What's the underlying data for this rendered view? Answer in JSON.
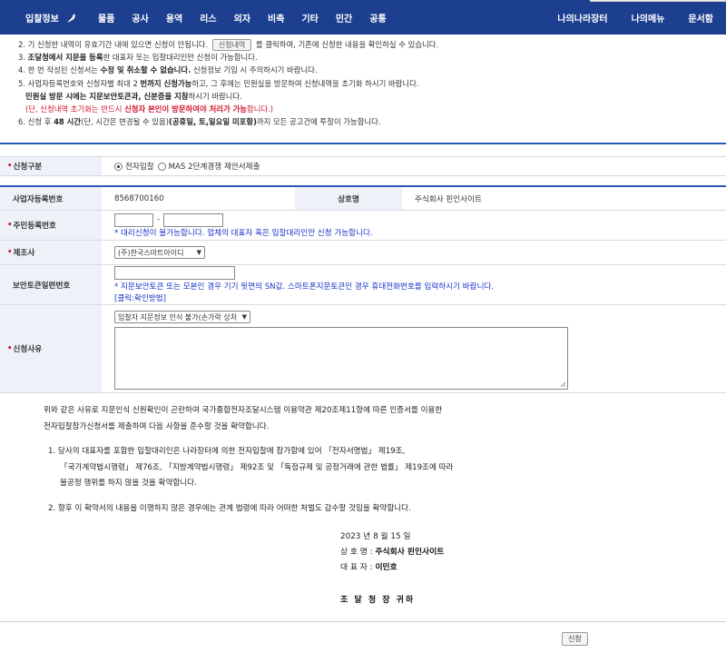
{
  "nav": {
    "logo": "입찰정보",
    "menu": [
      "물품",
      "공사",
      "용역",
      "리스",
      "외자",
      "비축",
      "기타",
      "민간",
      "공통"
    ],
    "right": [
      "나의나라장터",
      "나의메뉴",
      "문서함"
    ]
  },
  "notices": {
    "n2_pre": "2. 기 신청한 내역이 유효기간 내에 있으면 신청이 안됩니다.",
    "n2_btn": "신청내역",
    "n2_post": "를 클릭하여, 기존에 신청한 내용을 확인하실 수 있습니다.",
    "n3_pre": "3.",
    "n3_bold": "조달청에서 지문을 등록",
    "n3_post": "한 대표자 또는 입찰대리인만 신청이 가능합니다.",
    "n4_pre": "4. 한 번 작성된 신청서는",
    "n4_bold": "수정 및 취소할 수 없습니다.",
    "n4_post": "신청정보 기입 시 주의하시기 바랍니다.",
    "n5_pre": "5. 사업자등록번호와 신청자별 최대 2",
    "n5_bold": "번까지 신청가능",
    "n5_post": "하고, 그 후에는 민원실을 방문하여 신청내역을 초기화 하시기 바랍니다.",
    "n5b_bold1": "민원실 방문 시에는 지문보안토큰과, 신분증을 지참",
    "n5b_post": "하시기 바랍니다.",
    "n5c_pre": "(단, 신청내역 초기화는 반드시",
    "n5c_bold": "신청자 본인이 방문하여야 처리가 가능",
    "n5c_post": "합니다.)",
    "n6_pre": "6. 신청 후",
    "n6_bold1": "48 시간",
    "n6_mid": "(단, 시간은 변경될 수 있음)",
    "n6_bold2": "(공휴일, 토,일요일 미포함)",
    "n6_post": "까지 모든 공고건에 투찰이 가능합니다."
  },
  "form": {
    "req_type_label": "신청구분",
    "req_type_opt1": "전자입찰",
    "req_type_opt2": "MAS 2단계경쟁 제안서제출",
    "biz_no_label": "사업자등록번호",
    "biz_no_value": "8568700160",
    "company_label": "상호명",
    "company_value": "주식회사 핀인사이트",
    "rrn_label": "주민등록번호",
    "rrn_dash": "-",
    "rrn_hint": "* 대리신청이 불가능합니다. 업체의 대표자 혹은 입찰대리인만 신청 가능합니다.",
    "maker_label": "제조사",
    "maker_value": "(주)한국스마트아이디",
    "token_label": "보안토큰일련번호",
    "token_hint": "* 지문보안토큰 또는 모본인 경우 기기 뒷면의 SN값. 스마트폰지문토큰인 경우 휴대전화번호를 입력하시기 바랍니다.",
    "token_link": "[클릭:확인방법]",
    "reason_label": "신청사유",
    "reason_value": "입찰자 지문정보 인식 불가(손가락 상처 등)"
  },
  "pledge": {
    "p1": "위와 같은 사유로 지문인식 신원확인이 곤란하여 국가종합전자조달시스템 이용약관 제20조제11항에 따른 인증서를 이용한",
    "p2": "전자입찰참가신청서를 제출하며 다음 사항을 준수할 것을 확약합니다.",
    "i1a": "1. 당사의 대표자를 포함한 입찰대리인은 나라장터에 의한 전자입찰에 참가함에 있어 「전자서명법」 제19조,",
    "i1b": "「국가계약법시행령」 제76조, 「지방계약법시행령」 제92조 및 「독점규제 및 공정거래에 관한 법률」 제19조에 따라",
    "i1c": "불공정 행위를 하지 않을 것을 확약합니다.",
    "i2": "2. 향후 이 확약서의 내용을 이행하지 않은 경우에는 관계 법령에 따라 어떠한 처벌도 감수할 것임을 확약합니다."
  },
  "signature": {
    "date": "2023 년 8 월 15 일",
    "company_label": "상 호 명 :",
    "company": "주식회사 핀인사이트",
    "rep_label": "대 표 자 :",
    "rep": "이민호",
    "addressee": "조 달 청 장 귀하"
  },
  "submit_label": "신청"
}
